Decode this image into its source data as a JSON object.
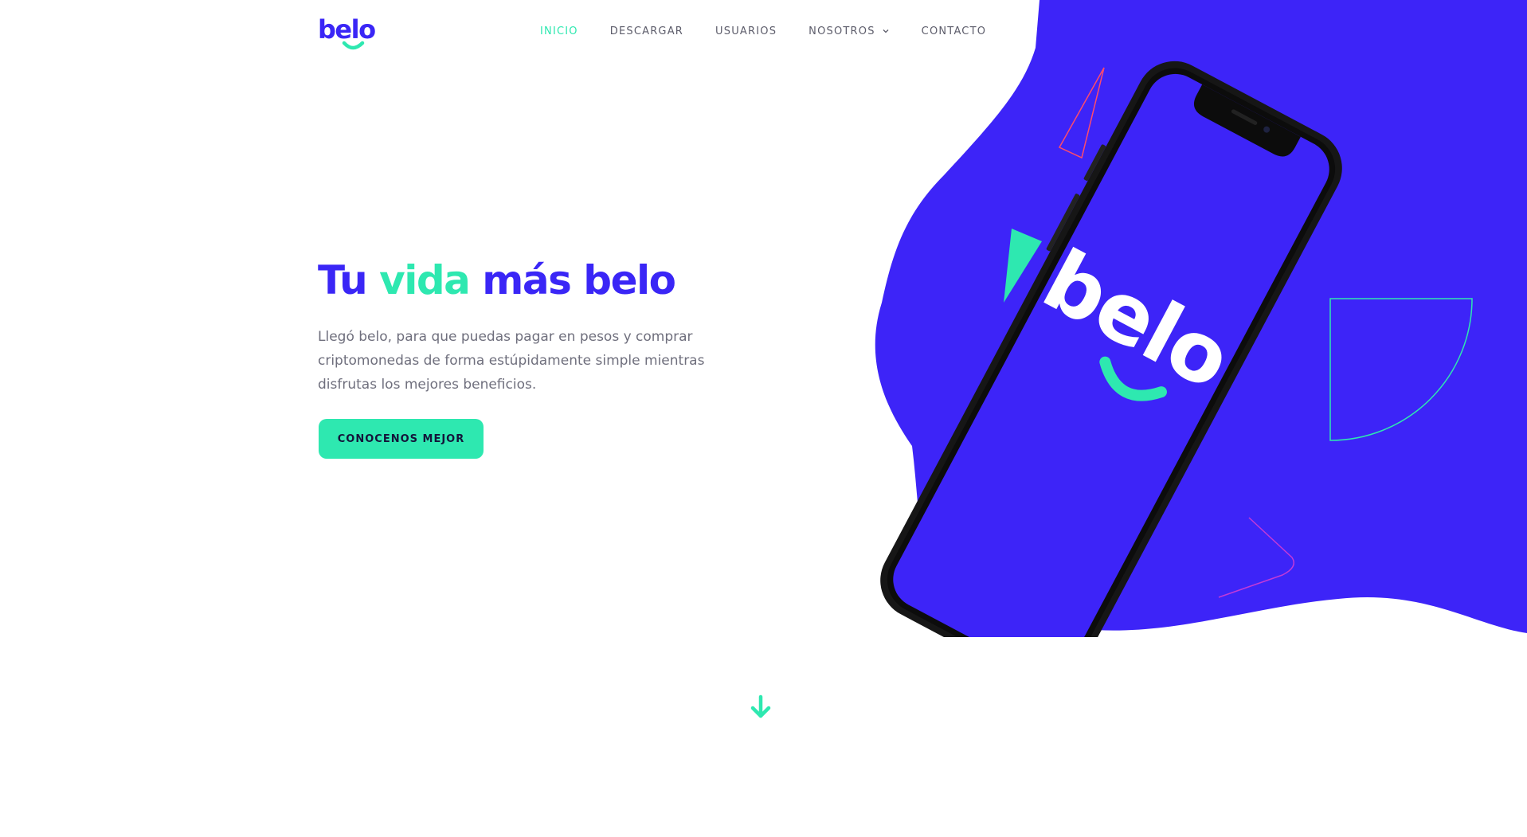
{
  "brand": {
    "name": "belo",
    "primary_color": "#3a26f6",
    "accent_color": "#2ee8b0"
  },
  "nav": {
    "items": [
      {
        "label": "INICIO",
        "active": true
      },
      {
        "label": "DESCARGAR",
        "active": false
      },
      {
        "label": "USUARIOS",
        "active": false
      },
      {
        "label": "NOSOTROS",
        "active": false,
        "has_dropdown": true
      },
      {
        "label": "CONTACTO",
        "active": false
      }
    ]
  },
  "hero": {
    "title_part1": "Tu ",
    "title_accent": "vida",
    "title_part2": " más belo",
    "description": "Llegó belo, para que puedas pagar en pesos y comprar criptomonedas de forma estúpidamente simple mientras disfrutas los mejores beneficios.",
    "cta_label": "CONOCENOS MEJOR"
  },
  "icons": {
    "scroll": "arrow-down-icon",
    "dropdown": "chevron-down-icon"
  }
}
